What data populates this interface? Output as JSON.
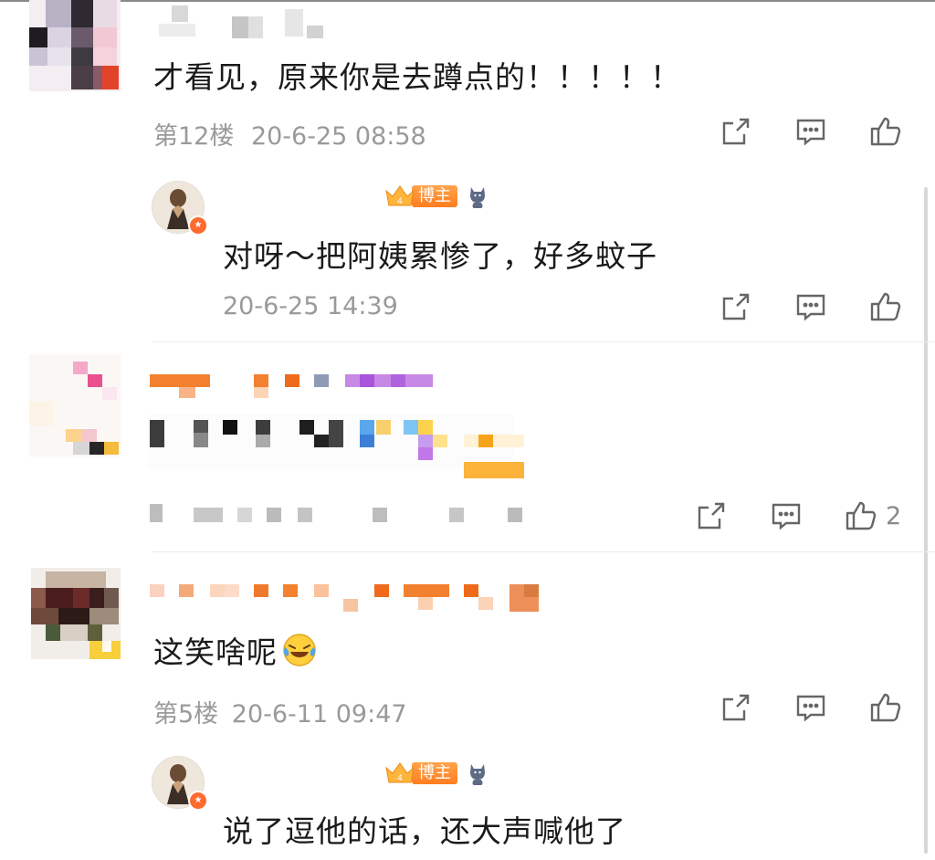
{
  "comments": [
    {
      "text": "才看见，原来你是去蹲点的！！！！！",
      "floor": "第12楼",
      "time": "20-6-25 08:58",
      "reply": {
        "badge": "博主",
        "text": "对呀～把阿姨累惨了，好多蚊子",
        "time": "20-6-25 14:39"
      }
    },
    {
      "like_count": "2"
    },
    {
      "text": "这笑啥呢",
      "floor": "第5楼",
      "time": "20-6-11 09:47",
      "reply": {
        "badge": "博主",
        "text": "说了逗他的话，还大声喊他了"
      }
    }
  ],
  "icons": {
    "repost": "share-icon",
    "comment": "comment-icon",
    "like": "thumbs-up-icon",
    "emoji": "laugh-cry-emoji-icon",
    "crown": "crown-level-icon",
    "cat": "cat-icon",
    "verified": "verified-badge-icon"
  },
  "colors": {
    "accent": "#ff7d1f",
    "meta_text": "#9a9a9a",
    "body_text": "#1a1a1a"
  }
}
